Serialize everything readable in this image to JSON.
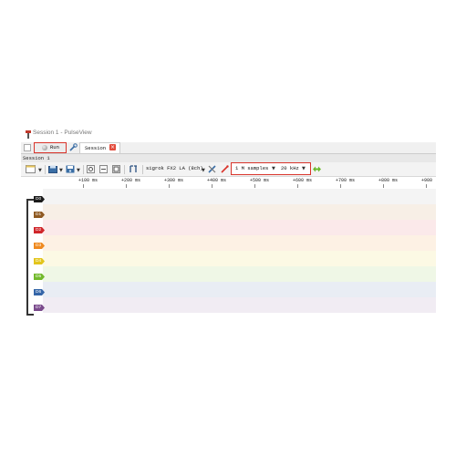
{
  "window": {
    "title": "Session 1 - PulseView"
  },
  "tabs": {
    "run_label": "Run",
    "session_tab_label": "Session 1",
    "close_glyph": "×"
  },
  "session_bar": {
    "label": "Session 1"
  },
  "toolbar": {
    "device": "sigrok FX2 LA (8ch)",
    "samples": "1 M samples",
    "samplerate": "20 kHz",
    "icons": [
      "new-file-icon",
      "open-icon",
      "save-icon",
      "zoom-in-icon",
      "zoom-out-icon",
      "zoom-fit-icon",
      "cursor-icon",
      "wrench-icon",
      "probe-icon",
      "config-icon"
    ]
  },
  "ruler": {
    "ticks": [
      "+100 ms",
      "+200 ms",
      "+300 ms",
      "+400 ms",
      "+500 ms",
      "+600 ms",
      "+700 ms",
      "+800 ms",
      "+900"
    ]
  },
  "channels": [
    {
      "name": "D0",
      "color": "#1b1b1b",
      "lane": "#f4f4f4"
    },
    {
      "name": "D1",
      "color": "#8f5a22",
      "lane": "#f7efe6"
    },
    {
      "name": "D2",
      "color": "#d0262b",
      "lane": "#fbe9ea"
    },
    {
      "name": "D3",
      "color": "#ef8a1f",
      "lane": "#fdf1e4"
    },
    {
      "name": "D4",
      "color": "#e3c51c",
      "lane": "#fcf9e4"
    },
    {
      "name": "D5",
      "color": "#72b92c",
      "lane": "#eff7e6"
    },
    {
      "name": "D6",
      "color": "#3566a8",
      "lane": "#e9edf4"
    },
    {
      "name": "D7",
      "color": "#7a4a8c",
      "lane": "#f1ecf3"
    }
  ]
}
